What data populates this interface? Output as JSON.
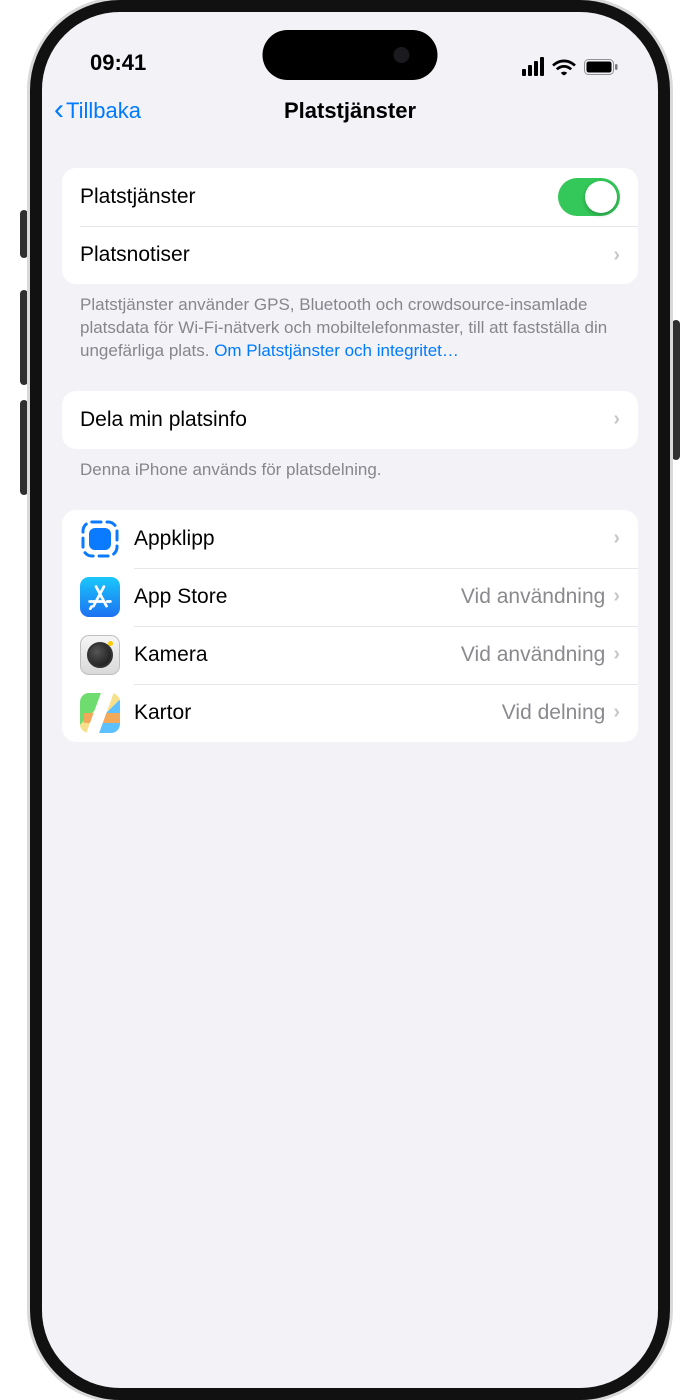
{
  "status": {
    "time": "09:41"
  },
  "nav": {
    "back": "Tillbaka",
    "title": "Platstjänster"
  },
  "group1": {
    "location_services": "Platstjänster",
    "location_alerts": "Platsnotiser"
  },
  "footer1": {
    "text": "Platstjänster använder GPS, Bluetooth och crowdsource-insamlade platsdata för Wi-Fi-nätverk och mobiltelefonmaster, till att fastställa din ungefärliga plats. ",
    "link": "Om Platstjänster och integritet…"
  },
  "group2": {
    "share_location": "Dela min platsinfo"
  },
  "footer2": {
    "text": "Denna iPhone används för platsdelning."
  },
  "apps": [
    {
      "name": "Appklipp",
      "detail": ""
    },
    {
      "name": "App Store",
      "detail": "Vid användning"
    },
    {
      "name": "Kamera",
      "detail": "Vid användning"
    },
    {
      "name": "Kartor",
      "detail": "Vid delning"
    }
  ]
}
